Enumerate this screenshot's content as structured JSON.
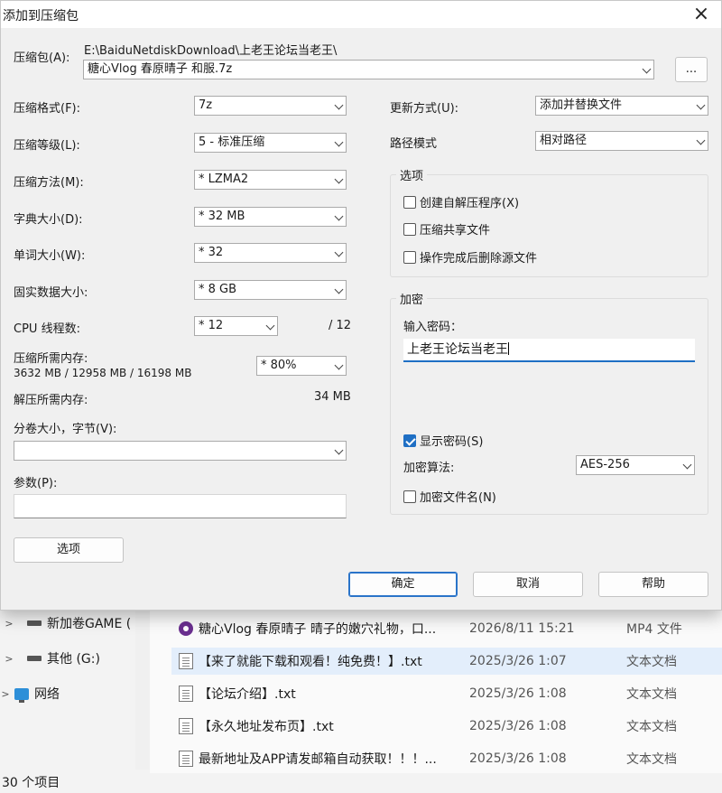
{
  "dialog": {
    "title": "添加到压缩包",
    "archive_label": "压缩包(A):",
    "archive_path": "E:\\BaiduNetdiskDownload\\上老王论坛当老王\\",
    "archive_name": "糖心Vlog 春原晴子 和服.7z",
    "browse_label": "...",
    "format_label": "压缩格式(F):",
    "format_value": "7z",
    "level_label": "压缩等级(L):",
    "level_value": "5 - 标准压缩",
    "method_label": "压缩方法(M):",
    "method_value": "* LZMA2",
    "dict_label": "字典大小(D):",
    "dict_value": "* 32 MB",
    "word_label": "单词大小(W):",
    "word_value": "* 32",
    "solid_label": "固实数据大小:",
    "solid_value": "* 8 GB",
    "threads_label": "CPU 线程数:",
    "threads_value": "* 12",
    "threads_total": "/ 12",
    "mem_compress_label": "压缩所需内存:",
    "mem_compress_detail": "3632 MB / 12958 MB / 16198 MB",
    "mem_percent_value": "* 80%",
    "mem_decompress_label": "解压所需内存:",
    "mem_decompress_value": "34 MB",
    "split_label": "分卷大小，字节(V):",
    "split_value": "",
    "params_label": "参数(P):",
    "params_value": "",
    "options_button": "选项",
    "update_label": "更新方式(U):",
    "update_value": "添加并替换文件",
    "path_mode_label": "路径模式",
    "path_mode_value": "相对路径",
    "options_group": {
      "title": "选项",
      "sfx": "创建自解压程序(X)",
      "shared": "压缩共享文件",
      "delete": "操作完成后删除源文件"
    },
    "encrypt_group": {
      "title": "加密",
      "password_label": "输入密码：",
      "password_value": "上老王论坛当老王",
      "show_password": "显示密码(S)",
      "algo_label": "加密算法:",
      "algo_value": "AES-256",
      "encrypt_names": "加密文件名(N)"
    },
    "ok": "确定",
    "cancel": "取消",
    "help": "帮助"
  },
  "explorer": {
    "nav": [
      {
        "label": "新加卷GAME (",
        "icon": "drive-icon"
      },
      {
        "label": "其他 (G:)",
        "icon": "drive-icon"
      },
      {
        "label": "网络",
        "icon": "network-icon"
      }
    ],
    "files": [
      {
        "name": "糖心Vlog 春原晴子 晴子的嫩穴礼物，口...",
        "date": "2026/8/11 15:21",
        "type": "MP4 文件"
      },
      {
        "name": "【来了就能下载和观看！纯免费！】.txt",
        "date": "2025/3/26 1:07",
        "type": "文本文档"
      },
      {
        "name": "【论坛介绍】.txt",
        "date": "2025/3/26 1:08",
        "type": "文本文档"
      },
      {
        "name": "【永久地址发布页】.txt",
        "date": "2025/3/26 1:08",
        "type": "文本文档"
      },
      {
        "name": "最新地址及APP请发邮箱自动获取！！！...",
        "date": "2025/3/26 1:08",
        "type": "文本文档"
      }
    ],
    "status": "30 个项目"
  }
}
